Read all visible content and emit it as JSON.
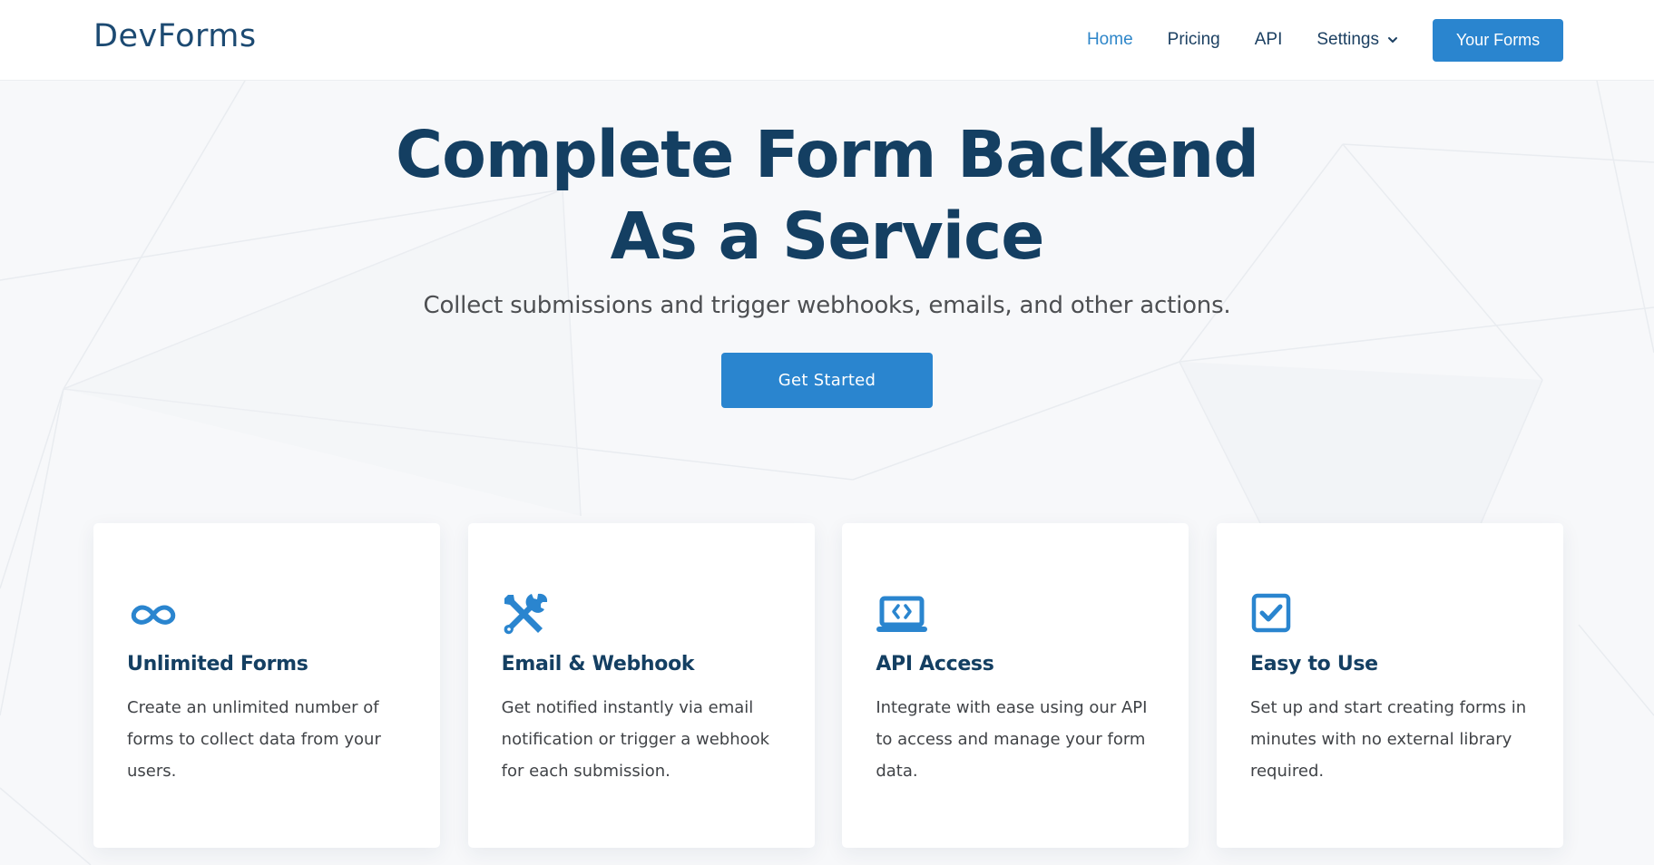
{
  "brand": "DevForms",
  "nav": {
    "items": [
      {
        "label": "Home",
        "active": true
      },
      {
        "label": "Pricing"
      },
      {
        "label": "API"
      },
      {
        "label": "Settings",
        "has_dropdown": true
      }
    ],
    "cta_label": "Your Forms"
  },
  "hero": {
    "title_line1": "Complete Form Backend",
    "title_line2": "As a Service",
    "subtitle": "Collect submissions and trigger webhooks, emails, and other actions.",
    "button_label": "Get Started"
  },
  "features": [
    {
      "icon": "infinity-icon",
      "title": "Unlimited Forms",
      "text": "Create an unlimited number of forms to collect data from your users."
    },
    {
      "icon": "tools-icon",
      "title": "Email & Webhook",
      "text": "Get notified instantly via email notification or trigger a webhook for each submission."
    },
    {
      "icon": "laptop-code-icon",
      "title": "API Access",
      "text": "Integrate with ease using our API to access and manage your form data."
    },
    {
      "icon": "check-square-icon",
      "title": "Easy to Use",
      "text": "Set up and start creating forms in minutes with no external library required."
    }
  ],
  "colors": {
    "accent": "#2a85cf",
    "heading": "#143f62",
    "body_text": "#404347",
    "background": "#f7f8fa"
  }
}
